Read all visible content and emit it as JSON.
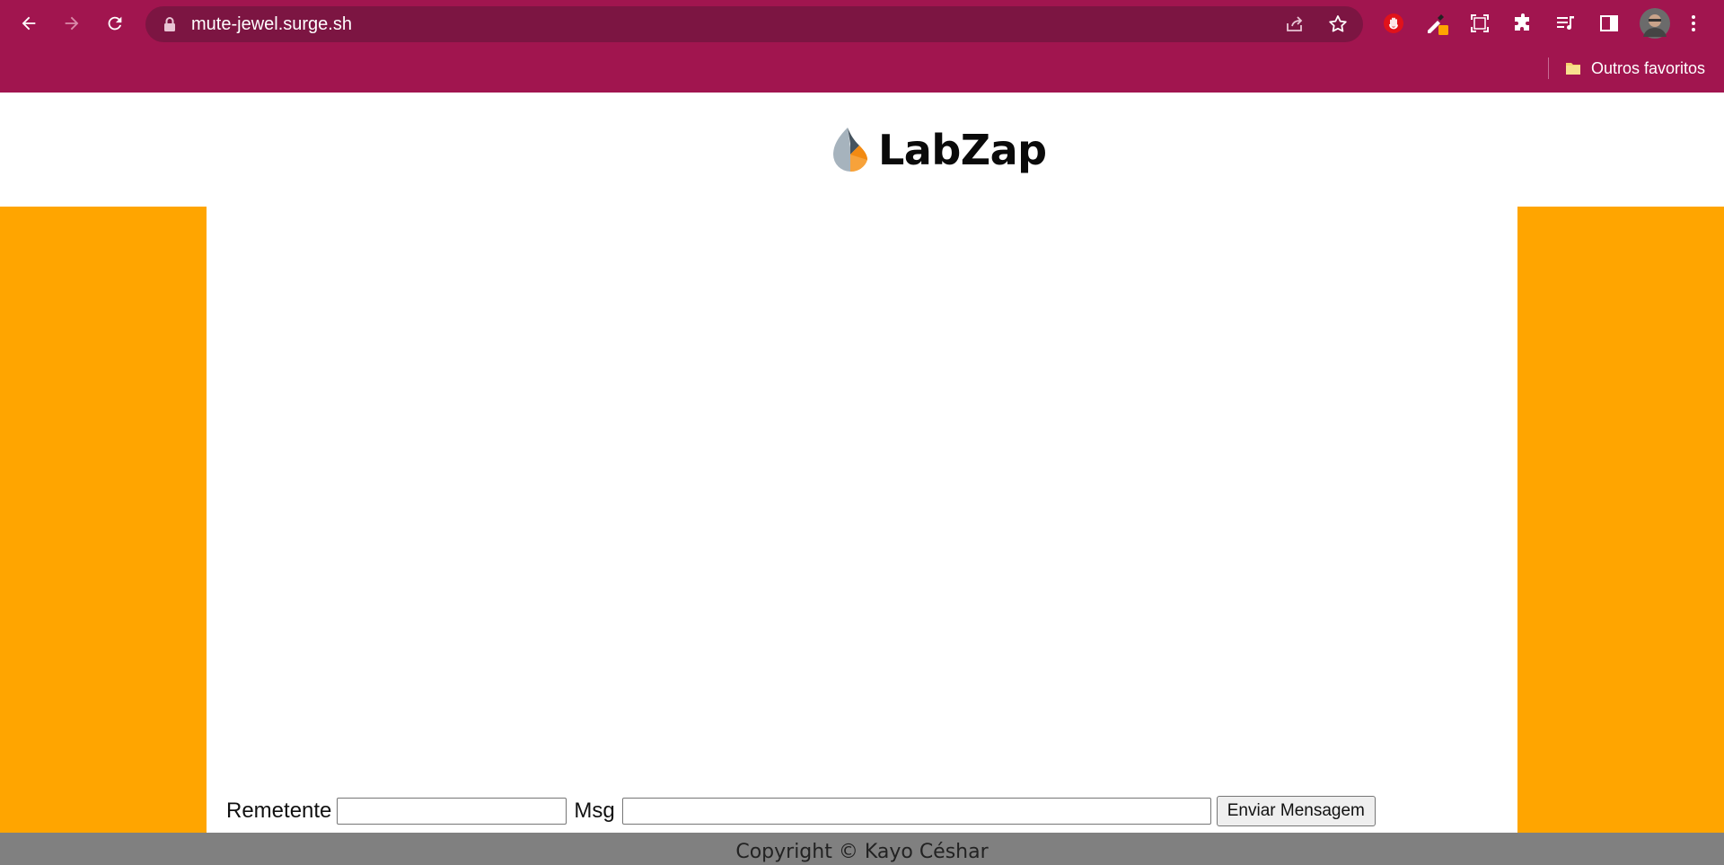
{
  "browser": {
    "url": "mute-jewel.surge.sh",
    "bookmark_folder": "Outros favoritos",
    "icons": [
      "back-arrow-icon",
      "forward-arrow-icon",
      "reload-icon",
      "lock-icon",
      "share-icon",
      "star-icon",
      "stop-hand-icon",
      "eyedropper-icon",
      "screenshot-icon",
      "puzzle-icon",
      "media-queue-icon",
      "side-panel-icon",
      "avatar",
      "more-vert-icon",
      "folder-icon"
    ],
    "theme_color": "#a1154f",
    "omnibox_color": "#7c1542"
  },
  "page": {
    "brand": "LabZap",
    "side_color": "#ffa500",
    "form": {
      "sender_label": "Remetente",
      "sender_value": "",
      "msg_label": "Msg",
      "msg_value": "",
      "send_button": "Enviar Mensagem"
    },
    "footer": "Copyright © Kayo Céshar"
  }
}
